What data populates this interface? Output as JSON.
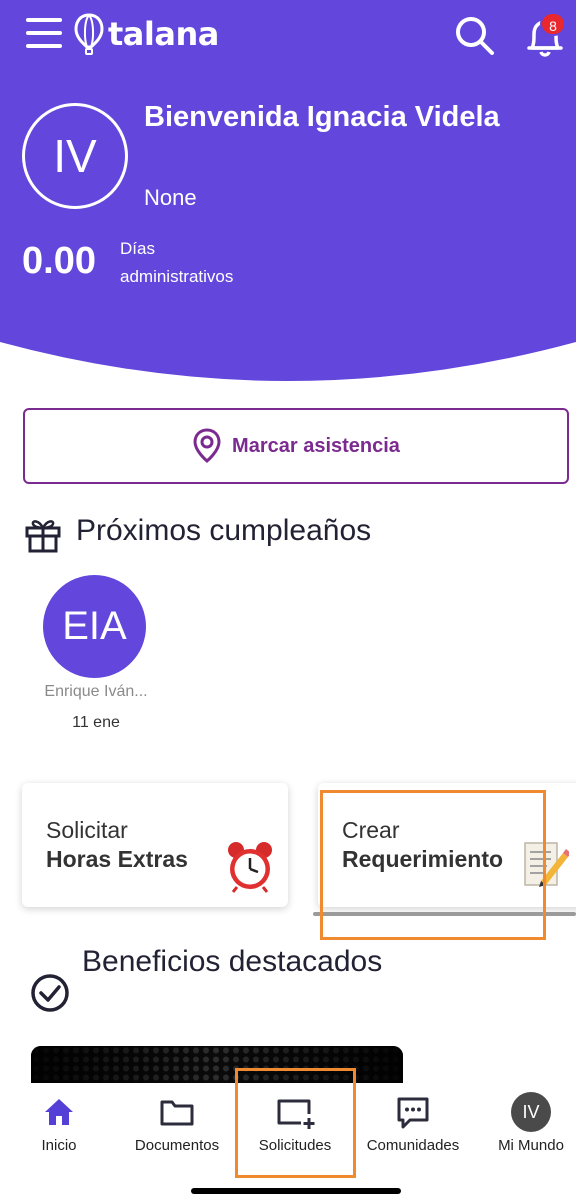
{
  "app": {
    "logo_text": "talana"
  },
  "header": {
    "notifications_count": "8",
    "avatar_initials": "IV",
    "welcome": "Bienvenida Ignacia Videla",
    "company": "None",
    "days_value": "0.00",
    "days_label": "Días administrativos",
    "background_color": "#6346dc"
  },
  "attendance": {
    "label": "Marcar asistencia",
    "color": "#7b2b8f"
  },
  "birthdays": {
    "title": "Próximos cumpleaños",
    "people": [
      {
        "initials": "EIA",
        "name": "Enrique Iván...",
        "date": "11 ene"
      }
    ]
  },
  "cards": [
    {
      "line1": "Solicitar",
      "line2": "Horas Extras",
      "icon": "alarm-clock-icon"
    },
    {
      "line1": "Crear",
      "line2": "Requerimiento",
      "icon": "memo-icon"
    }
  ],
  "benefits": {
    "title": "Beneficios destacados"
  },
  "nav": {
    "items": [
      {
        "label": "Inicio",
        "icon": "home-icon"
      },
      {
        "label": "Documentos",
        "icon": "folder-icon"
      },
      {
        "label": "Solicitudes",
        "icon": "add-request-icon"
      },
      {
        "label": "Comunidades",
        "icon": "chat-icon"
      },
      {
        "label": "Mi Mundo",
        "icon": "avatar",
        "initials": "IV"
      }
    ]
  },
  "highlight_color": "#f08a30"
}
